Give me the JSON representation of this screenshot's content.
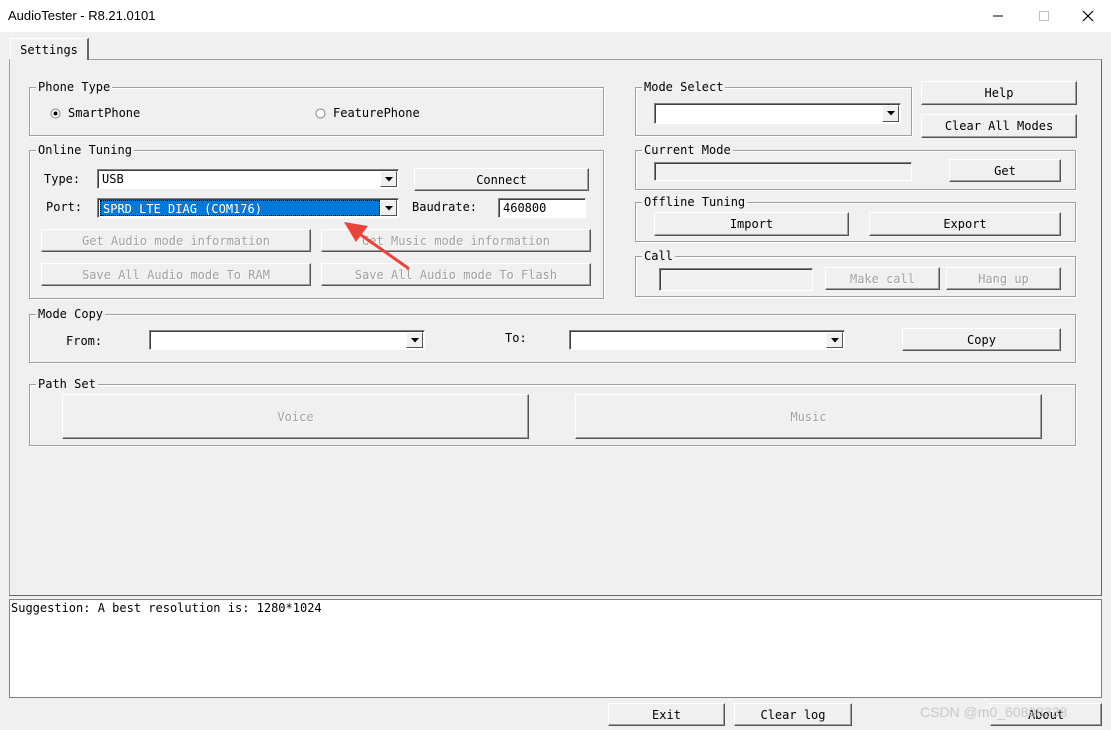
{
  "window": {
    "title": "AudioTester - R8.21.0101"
  },
  "tabs": [
    {
      "label": "Settings"
    }
  ],
  "phone_type": {
    "label": "Phone Type",
    "options": [
      "SmartPhone",
      "FeaturePhone"
    ],
    "selected": "SmartPhone"
  },
  "online_tuning": {
    "label": "Online Tuning",
    "type_label": "Type:",
    "type_value": "USB",
    "port_label": "Port:",
    "port_value": "SPRD LTE DIAG (COM176)",
    "connect_label": "Connect",
    "baudrate_label": "Baudrate:",
    "baudrate_value": "460800",
    "get_audio": "Get Audio mode information",
    "get_music": "Get Music mode information",
    "save_ram": "Save All Audio mode To RAM",
    "save_flash": "Save All Audio mode To Flash"
  },
  "mode_select": {
    "label": "Mode Select",
    "value": ""
  },
  "help_label": "Help",
  "clear_all_label": "Clear All Modes",
  "current_mode": {
    "label": "Current Mode",
    "value": "",
    "get_label": "Get"
  },
  "offline_tuning": {
    "label": "Offline Tuning",
    "import_label": "Import",
    "export_label": "Export"
  },
  "call": {
    "label": "Call",
    "value": "",
    "make_call_label": "Make call",
    "hang_up_label": "Hang up"
  },
  "mode_copy": {
    "label": "Mode Copy",
    "from_label": "From:",
    "to_label": "To:",
    "copy_label": "Copy"
  },
  "path_set": {
    "label": "Path Set",
    "voice_label": "Voice",
    "music_label": "Music"
  },
  "log": {
    "text": "Suggestion: A best resolution is: 1280*1024"
  },
  "footer": {
    "exit_label": "Exit",
    "clear_log_label": "Clear log",
    "about_label": "About"
  },
  "watermark": "CSDN @m0_60898338",
  "annotation_color": "#e8453c"
}
